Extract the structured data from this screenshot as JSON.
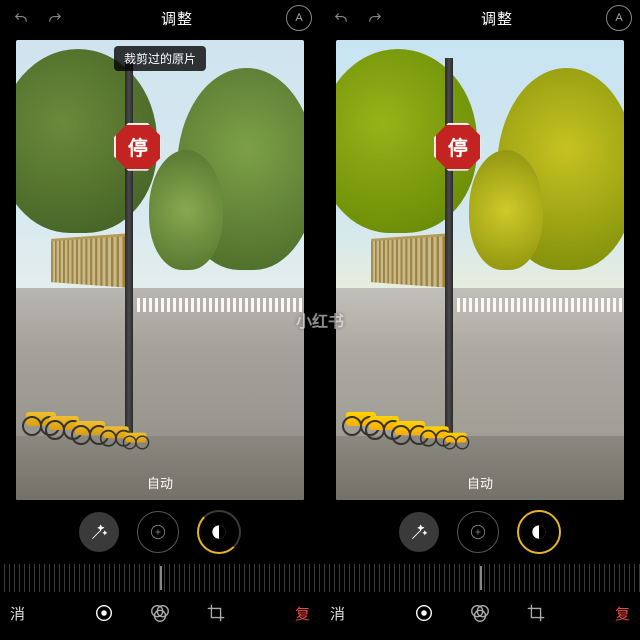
{
  "app": {
    "title": "调整"
  },
  "labels": {
    "cropped_original_pill": "裁剪过的原片",
    "auto": "自动",
    "stop_sign": "停",
    "cancel_partial": "消",
    "reset_partial_left": "复",
    "reset_partial_right": "复",
    "markers_icon": "A"
  },
  "watermark": "小红书",
  "tools": {
    "wand": "auto-enhance-wand",
    "exposure": "exposure",
    "filters": "filters"
  },
  "tabs": {
    "adjust": "adjust",
    "filters": "filters",
    "crop": "crop"
  }
}
